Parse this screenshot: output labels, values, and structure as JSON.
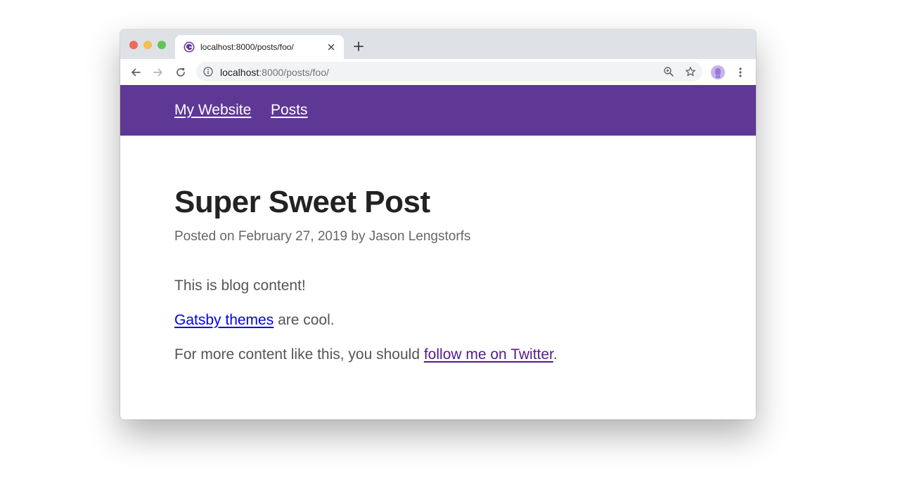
{
  "browser": {
    "tab_title": "localhost:8000/posts/foo/",
    "url_host": "localhost",
    "url_rest": ":8000/posts/foo/",
    "favicon_icon": "gatsby-icon",
    "colors": {
      "titlebar": "#dee1e6",
      "omnibox": "#f1f3f4"
    }
  },
  "site": {
    "nav": {
      "home": "My Website",
      "posts": "Posts"
    },
    "header_color": "#5f3795"
  },
  "post": {
    "title": "Super Sweet Post",
    "meta": "Posted on February 27, 2019 by Jason Lengstorfs",
    "p1": "This is blog content!",
    "p2_link": "Gatsby themes",
    "p2_text": " are cool.",
    "p3_text": "For more content like this, you should ",
    "p3_link": "follow me on Twitter",
    "p3_end": "."
  }
}
